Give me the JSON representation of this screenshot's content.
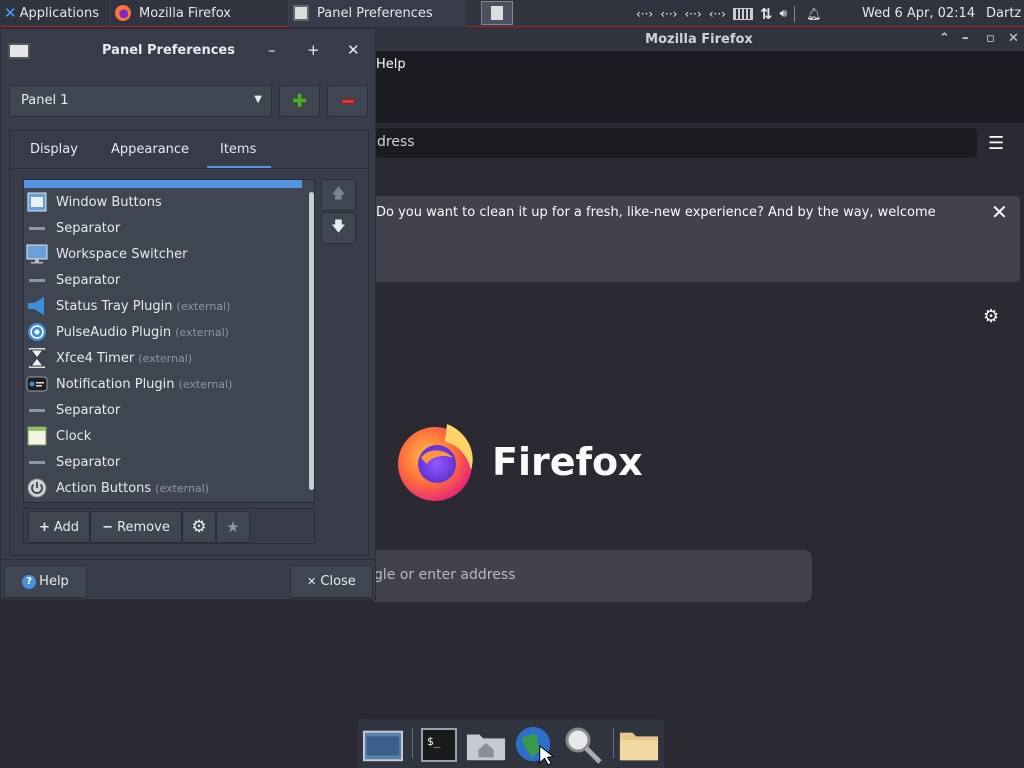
{
  "top_panel": {
    "applications_label": "Applications",
    "tasks": [
      {
        "label": "Mozilla Firefox"
      },
      {
        "label": "Panel Preferences"
      }
    ],
    "tray_network_glyphs": [
      "‹··›",
      "‹··›",
      "‹··›",
      "‹··›"
    ],
    "clock": "Wed  6 Apr, 02:14",
    "user": "Dartz"
  },
  "firefox": {
    "window_title": "Mozilla Firefox",
    "menu_help": "Help",
    "url_placeholder": "dress",
    "notice_text": "Do you want to clean it up for a fresh, like-new experience? And by the way, welcome",
    "wordmark": "Firefox",
    "search_placeholder": "gle or enter address"
  },
  "dialog": {
    "title": "Panel Preferences",
    "panel_select": "Panel 1",
    "tabs": [
      "Display",
      "Appearance",
      "Items"
    ],
    "active_tab": "Items",
    "items": [
      {
        "label": "Window Buttons",
        "ext": "",
        "icon": "window-buttons-icon"
      },
      {
        "label": "Separator",
        "ext": "",
        "icon": "separator-icon"
      },
      {
        "label": "Workspace Switcher",
        "ext": "",
        "icon": "workspace-switcher-icon"
      },
      {
        "label": "Separator",
        "ext": "",
        "icon": "separator-icon"
      },
      {
        "label": "Status Tray Plugin",
        "ext": "(external)",
        "icon": "status-tray-icon"
      },
      {
        "label": "PulseAudio Plugin",
        "ext": "(external)",
        "icon": "pulseaudio-icon"
      },
      {
        "label": "Xfce4 Timer",
        "ext": "(external)",
        "icon": "hourglass-icon"
      },
      {
        "label": "Notification Plugin",
        "ext": "(external)",
        "icon": "notification-icon"
      },
      {
        "label": "Separator",
        "ext": "",
        "icon": "separator-icon"
      },
      {
        "label": "Clock",
        "ext": "",
        "icon": "clock-icon"
      },
      {
        "label": "Separator",
        "ext": "",
        "icon": "separator-icon"
      },
      {
        "label": "Action Buttons",
        "ext": "(external)",
        "icon": "power-icon"
      }
    ],
    "toolbar": {
      "add": "Add",
      "remove": "Remove"
    },
    "help_label": "Help",
    "close_label": "Close"
  },
  "colors": {
    "accent": "#5294e2",
    "dialog_bg": "#383c4a",
    "firefox_bg": "#2b2a33"
  }
}
